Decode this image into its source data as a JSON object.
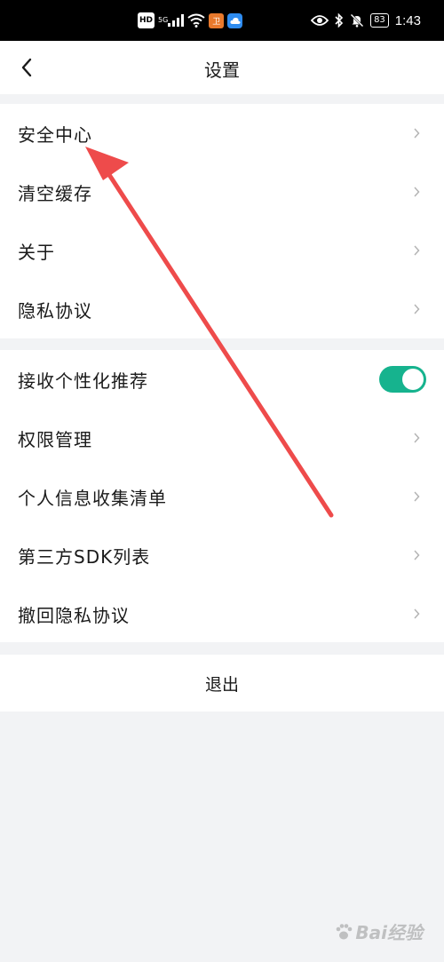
{
  "status_bar": {
    "hd": "HD",
    "network": "5G",
    "app_badge": "卫",
    "battery": "83",
    "time": "1:43"
  },
  "header": {
    "title": "设置",
    "back_icon": "chevron-left-icon"
  },
  "group1": {
    "items": [
      {
        "label": "安全中心"
      },
      {
        "label": "清空缓存"
      },
      {
        "label": "关于"
      },
      {
        "label": "隐私协议"
      }
    ]
  },
  "group2": {
    "toggle_item": {
      "label": "接收个性化推荐",
      "enabled": true
    },
    "items": [
      {
        "label": "权限管理"
      },
      {
        "label": "个人信息收集清单"
      },
      {
        "label": "第三方SDK列表"
      },
      {
        "label": "撤回隐私协议"
      }
    ]
  },
  "logout": {
    "label": "退出"
  },
  "watermark": {
    "text": "Bai经验"
  },
  "colors": {
    "toggle_on": "#16b38e",
    "annotation_arrow": "#ee4b4b",
    "page_bg": "#f2f3f5"
  }
}
